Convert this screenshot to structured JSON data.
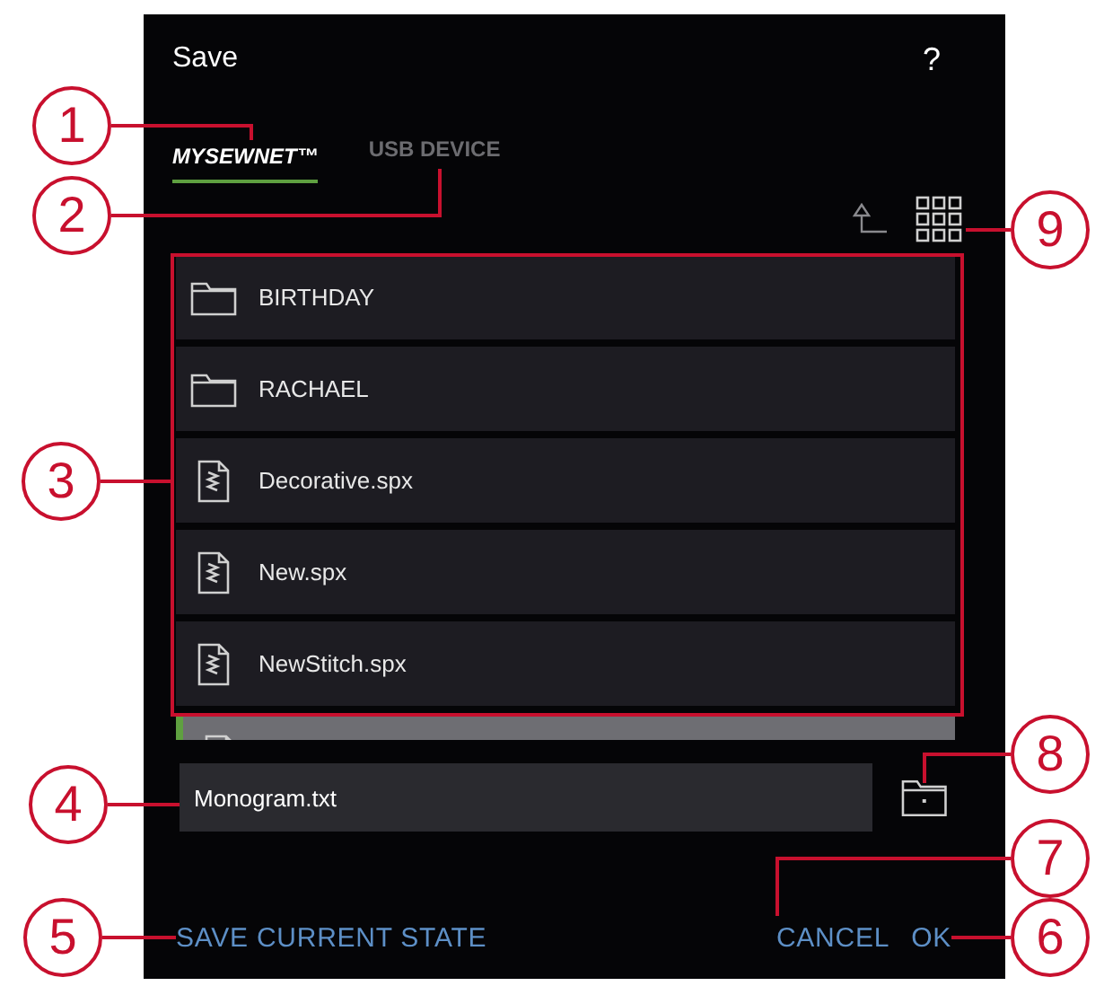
{
  "dialog": {
    "title": "Save",
    "help": "?"
  },
  "tabs": [
    {
      "label": "MYSEWNET™",
      "selected": true
    },
    {
      "label": "USB DEVICE",
      "selected": false
    }
  ],
  "files": [
    {
      "kind": "folder",
      "name": "BIRTHDAY",
      "selected": false
    },
    {
      "kind": "folder",
      "name": "RACHAEL",
      "selected": false
    },
    {
      "kind": "file",
      "name": "Decorative.spx",
      "selected": false
    },
    {
      "kind": "file",
      "name": "New.spx",
      "selected": false
    },
    {
      "kind": "file",
      "name": "NewStitch.spx",
      "selected": false
    },
    {
      "kind": "file",
      "selected": true
    }
  ],
  "filename": {
    "value": "Monogram.txt"
  },
  "buttons": [
    {
      "label": "SAVE CURRENT STATE"
    },
    {
      "label": "CANCEL"
    },
    {
      "label": "OK"
    }
  ],
  "callouts": [
    {
      "label": "1"
    },
    {
      "label": "2"
    },
    {
      "label": "3"
    },
    {
      "label": "4"
    },
    {
      "label": "5"
    },
    {
      "label": "9"
    },
    {
      "label": "8"
    },
    {
      "label": "7"
    },
    {
      "label": "6"
    }
  ]
}
